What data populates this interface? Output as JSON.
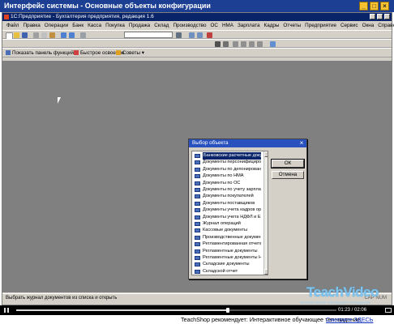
{
  "outer": {
    "title": "Интерфейс системы - Основные объекты конфигурации"
  },
  "app": {
    "title": "1С:Предприятие - Бухгалтерия предприятия, редакция 1.6"
  },
  "menu": [
    "Файл",
    "Правка",
    "Операции",
    "Банк",
    "Касса",
    "Покупка",
    "Продажа",
    "Склад",
    "Производство",
    "ОС",
    "НМА",
    "Зарплата",
    "Кадры",
    "Отчеты",
    "Предприятие",
    "Сервис",
    "Окна",
    "Справка"
  ],
  "panel_toolbar": {
    "show_panel": "Показать панель функций",
    "quick_start": "Быстрое освоение",
    "tips": "Советы"
  },
  "dialog": {
    "title": "Выбор объекта",
    "ok": "ОК",
    "cancel": "Отмена",
    "items": [
      "Банковские расчетные доку...",
      "Документы персонифициро...",
      "Документы по депонирование",
      "Документы по НМА",
      "Документы по ОС",
      "Документы по учету зарплаты",
      "Документы покупателей",
      "Документы поставщиков",
      "Документы учета кадров орг...",
      "Документы учета НДФЛ и Е...",
      "Журнал операций",
      "Кассовые документы",
      "Производственные документы",
      "Регламентированная отчетно...",
      "Регламентные документы",
      "Регламентные документы НДС",
      "Складские документы",
      "Складской отчет"
    ],
    "selected_index": 0
  },
  "status": {
    "text": "Выбрать журнал документов из списка и открыть",
    "indicators": "CAP  NUM"
  },
  "watermark": {
    "logo": "TeachVideo",
    "tagline": "Интерактивное обучающее телевидение"
  },
  "player": {
    "time": "01:23 / 02:06",
    "progress": 0.66
  },
  "promo": {
    "text": "TeachShop рекомендует: Интерактивное обучающее телевидение",
    "link": "Смотрите ЗДЕСЬ"
  }
}
